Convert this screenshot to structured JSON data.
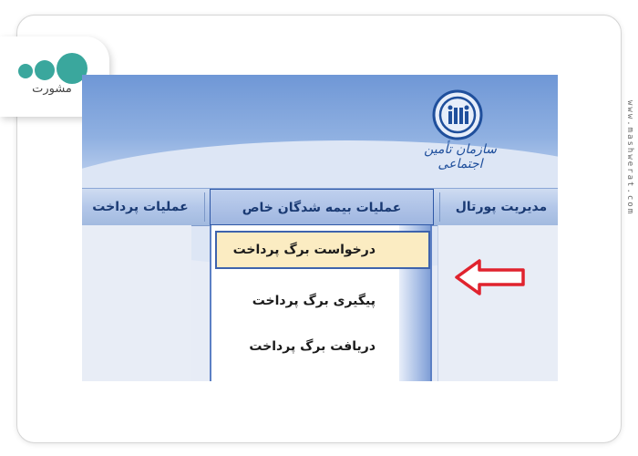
{
  "brand": {
    "logo_text": "مشورت",
    "watermark": "www.mashwerat.com",
    "accent": "#3aa79d"
  },
  "screenshot": {
    "org_name": "سازمان تأمین اجتماعی",
    "nav_tabs": [
      {
        "label": "مدیریت پورتال"
      },
      {
        "label": "عملیات بیمه شدگان خاص"
      },
      {
        "label": "عملیات پرداخت"
      }
    ],
    "dropdown_items": [
      {
        "label": "درخواست برگ پرداخت"
      },
      {
        "label": "پیگیری برگ پرداخت"
      },
      {
        "label": "دریافت برگ پرداخت"
      }
    ],
    "colors": {
      "nav_text": "#1a3a73",
      "highlight_bg": "#fbecc2",
      "arrow": "#e0232e"
    }
  }
}
